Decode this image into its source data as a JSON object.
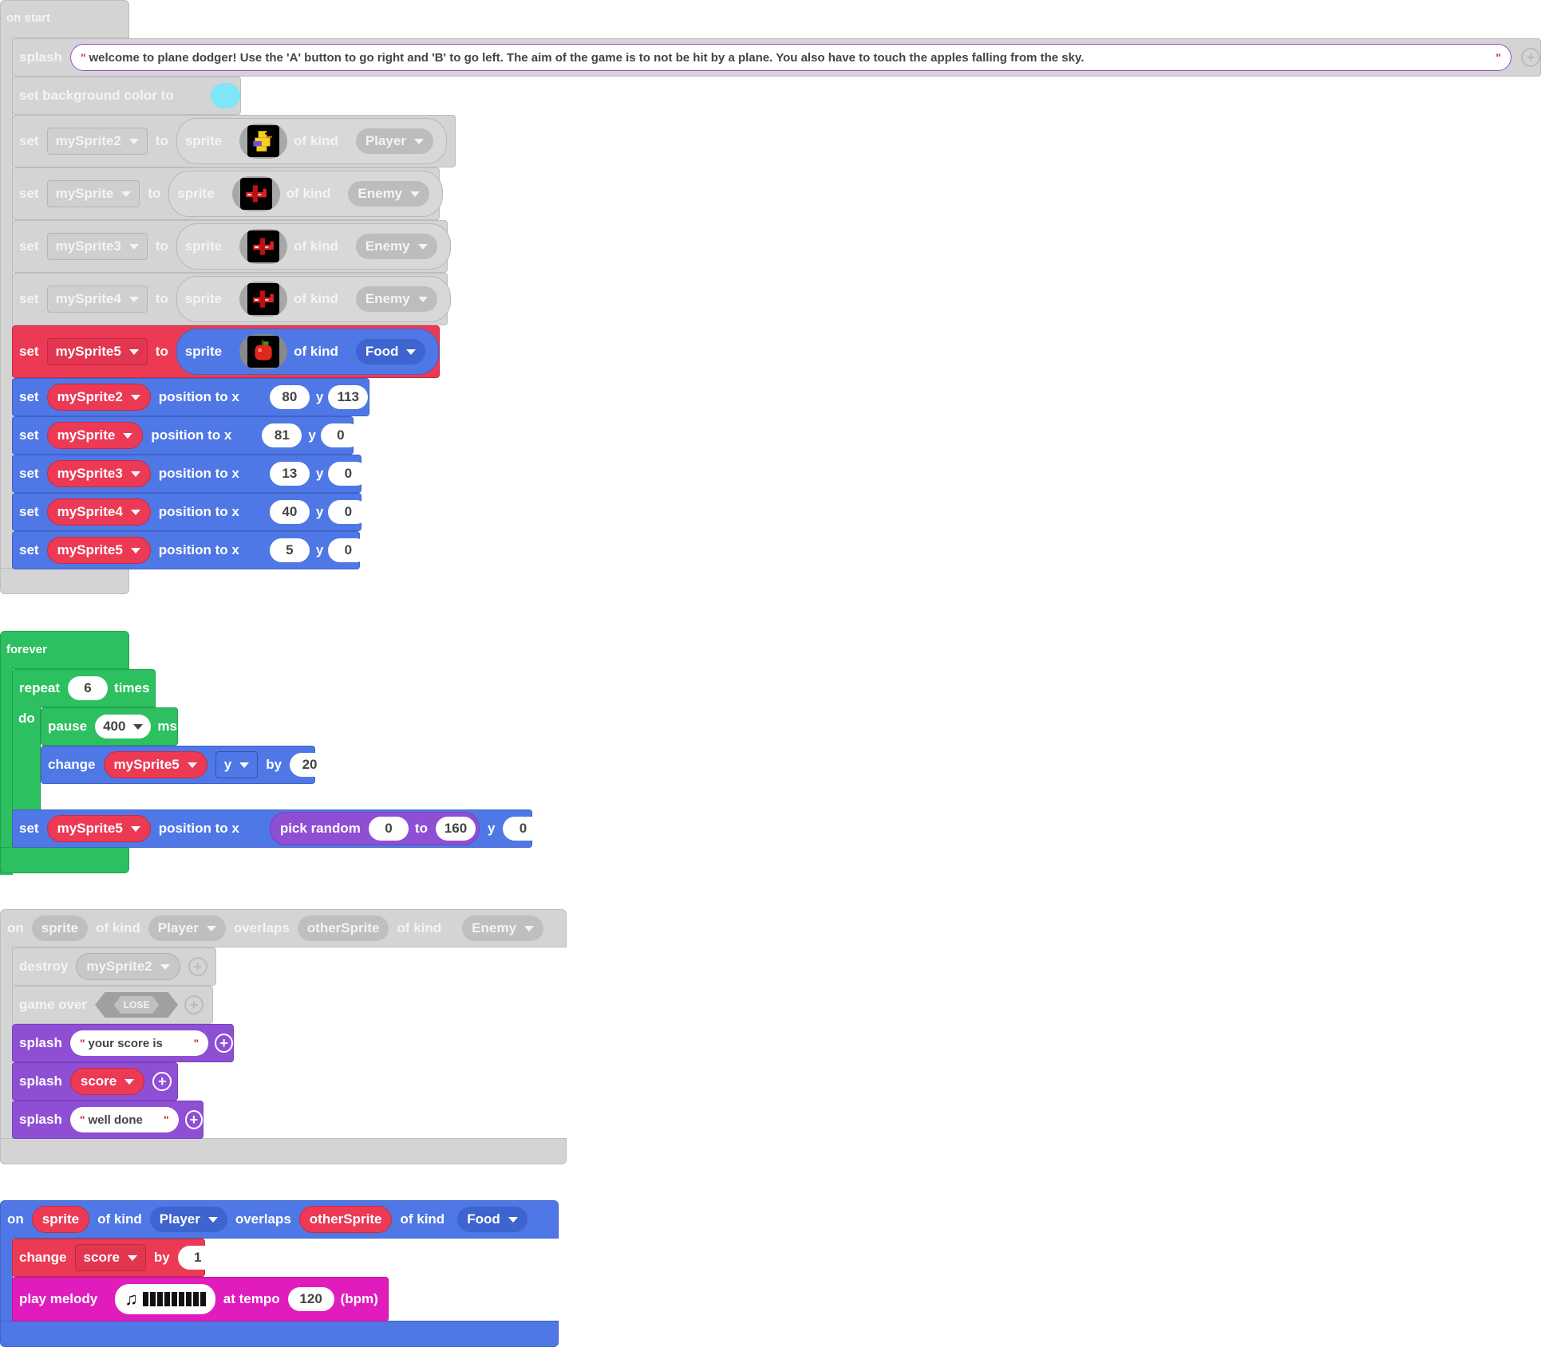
{
  "on_start": {
    "label": "on start",
    "splash_label": "splash",
    "splash_text": "welcome to plane dodger!  Use the 'A' button to go right and 'B' to go left.   The aim of the game is to not be hit by a plane. You also have to touch the apples falling from the sky.",
    "bg_label": "set background color to",
    "bg_color": "#7fe6f8",
    "sprites": [
      {
        "set": "set",
        "var": "mySprite2",
        "to": "to",
        "sprite": "sprite",
        "kind_label": "of kind",
        "kind": "Player",
        "image": "duck-sprite-icon",
        "active": false
      },
      {
        "set": "set",
        "var": "mySprite",
        "to": "to",
        "sprite": "sprite",
        "kind_label": "of kind",
        "kind": "Enemy",
        "image": "plane-sprite-icon",
        "active": false
      },
      {
        "set": "set",
        "var": "mySprite3",
        "to": "to",
        "sprite": "sprite",
        "kind_label": "of kind",
        "kind": "Enemy",
        "image": "plane-sprite-icon",
        "active": false
      },
      {
        "set": "set",
        "var": "mySprite4",
        "to": "to",
        "sprite": "sprite",
        "kind_label": "of kind",
        "kind": "Enemy",
        "image": "plane-sprite-icon",
        "active": false
      },
      {
        "set": "set",
        "var": "mySprite5",
        "to": "to",
        "sprite": "sprite",
        "kind_label": "of kind",
        "kind": "Food",
        "image": "apple-sprite-icon",
        "active": true
      }
    ],
    "positions": [
      {
        "set": "set",
        "var": "mySprite2",
        "pos": "position to x",
        "x": "80",
        "y_label": "y",
        "y": "113"
      },
      {
        "set": "set",
        "var": "mySprite",
        "pos": "position to x",
        "x": "81",
        "y_label": "y",
        "y": "0"
      },
      {
        "set": "set",
        "var": "mySprite3",
        "pos": "position to x",
        "x": "13",
        "y_label": "y",
        "y": "0"
      },
      {
        "set": "set",
        "var": "mySprite4",
        "pos": "position to x",
        "x": "40",
        "y_label": "y",
        "y": "0"
      },
      {
        "set": "set",
        "var": "mySprite5",
        "pos": "position to x",
        "x": "5",
        "y_label": "y",
        "y": "0"
      }
    ]
  },
  "forever": {
    "label": "forever",
    "repeat_label": "repeat",
    "repeat_count": "6",
    "times_label": "times",
    "do_label": "do",
    "pause_label": "pause",
    "pause_value": "400",
    "ms_label": "ms",
    "change_label": "change",
    "change_var": "mySprite5",
    "change_axis": "y",
    "by_label": "by",
    "change_value": "20",
    "set_label": "set",
    "set_var": "mySprite5",
    "pos_label": "position to x",
    "random_label": "pick random",
    "random_from": "0",
    "random_to_label": "to",
    "random_to": "160",
    "y_label": "y",
    "y_value": "0"
  },
  "overlap_enemy": {
    "on": "on",
    "sprite": "sprite",
    "of_kind": "of kind",
    "kind1": "Player",
    "overlaps": "overlaps",
    "other": "otherSprite",
    "of_kind2": "of kind",
    "kind2": "Enemy",
    "destroy_label": "destroy",
    "destroy_var": "mySprite2",
    "game_over_label": "game over",
    "game_over_value": "LOSE",
    "splash1_label": "splash",
    "splash1_text": "your score is",
    "splash2_label": "splash",
    "splash2_var": "score",
    "splash3_label": "splash",
    "splash3_text": "well done"
  },
  "overlap_food": {
    "on": "on",
    "sprite": "sprite",
    "of_kind": "of kind",
    "kind1": "Player",
    "overlaps": "overlaps",
    "other": "otherSprite",
    "of_kind2": "of kind",
    "kind2": "Food",
    "change_label": "change",
    "change_var": "score",
    "by_label": "by",
    "change_value": "1",
    "melody_label": "play melody",
    "tempo_label": "at tempo",
    "tempo_value": "120",
    "bpm_label": "(bpm)"
  },
  "colors": {
    "disabled": "#d4d4d4",
    "sprites": "#4f78e6",
    "variables": "#ec3a55",
    "loops": "#2cc060",
    "game": "#8f4fd4",
    "music": "#e01dbc"
  }
}
